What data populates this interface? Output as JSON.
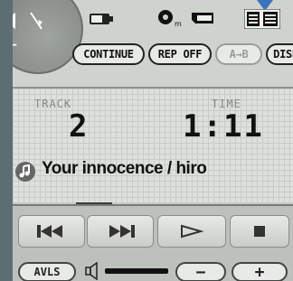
{
  "top": {
    "dial_plus": "+",
    "dial_minus": "−",
    "icons": [
      "speaker-icon",
      "battery-icon",
      "disc-icon",
      "memory-card-icon",
      "list-view-icon"
    ],
    "disc_sub": "m"
  },
  "buttons": {
    "continue": "CONTINUE",
    "rep_off": "REP OFF",
    "ab": "A→B",
    "disp": "DISP"
  },
  "display": {
    "track_label": "TRACK",
    "time_label": "TIME",
    "track_number": "2",
    "time": "1:11",
    "song_title": "Your innocence / hiro"
  },
  "controls": {
    "avls": "AVLS",
    "vol_down": "−",
    "vol_up": "+"
  },
  "colors": {
    "background": "#5d6e73",
    "device": "#c7cbc6",
    "pointer": "#3b74b8"
  }
}
